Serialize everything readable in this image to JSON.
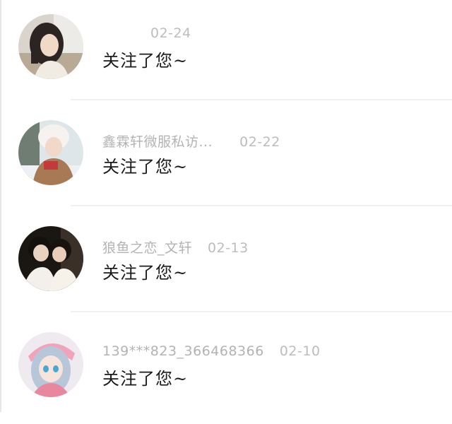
{
  "notifications": [
    {
      "name": "",
      "date": "02-24",
      "message": "关注了您~",
      "avatar_icon": "user-avatar-girl-portrait"
    },
    {
      "name": "鑫霖轩微服私访...",
      "date": "02-22",
      "message": "关注了您~",
      "avatar_icon": "user-avatar-girl-winter-hat"
    },
    {
      "name": "狼鱼之恋_文轩",
      "date": "02-13",
      "message": "关注了您~",
      "avatar_icon": "user-avatar-couple"
    },
    {
      "name": "139***823_366468366",
      "date": "02-10",
      "message": "关注了您~",
      "avatar_icon": "user-avatar-anime-girl"
    }
  ],
  "colors": {
    "meta_text": "#b3b3b3",
    "message_text": "#1a1a1a",
    "divider": "#f1f1f1",
    "background": "#ffffff"
  }
}
